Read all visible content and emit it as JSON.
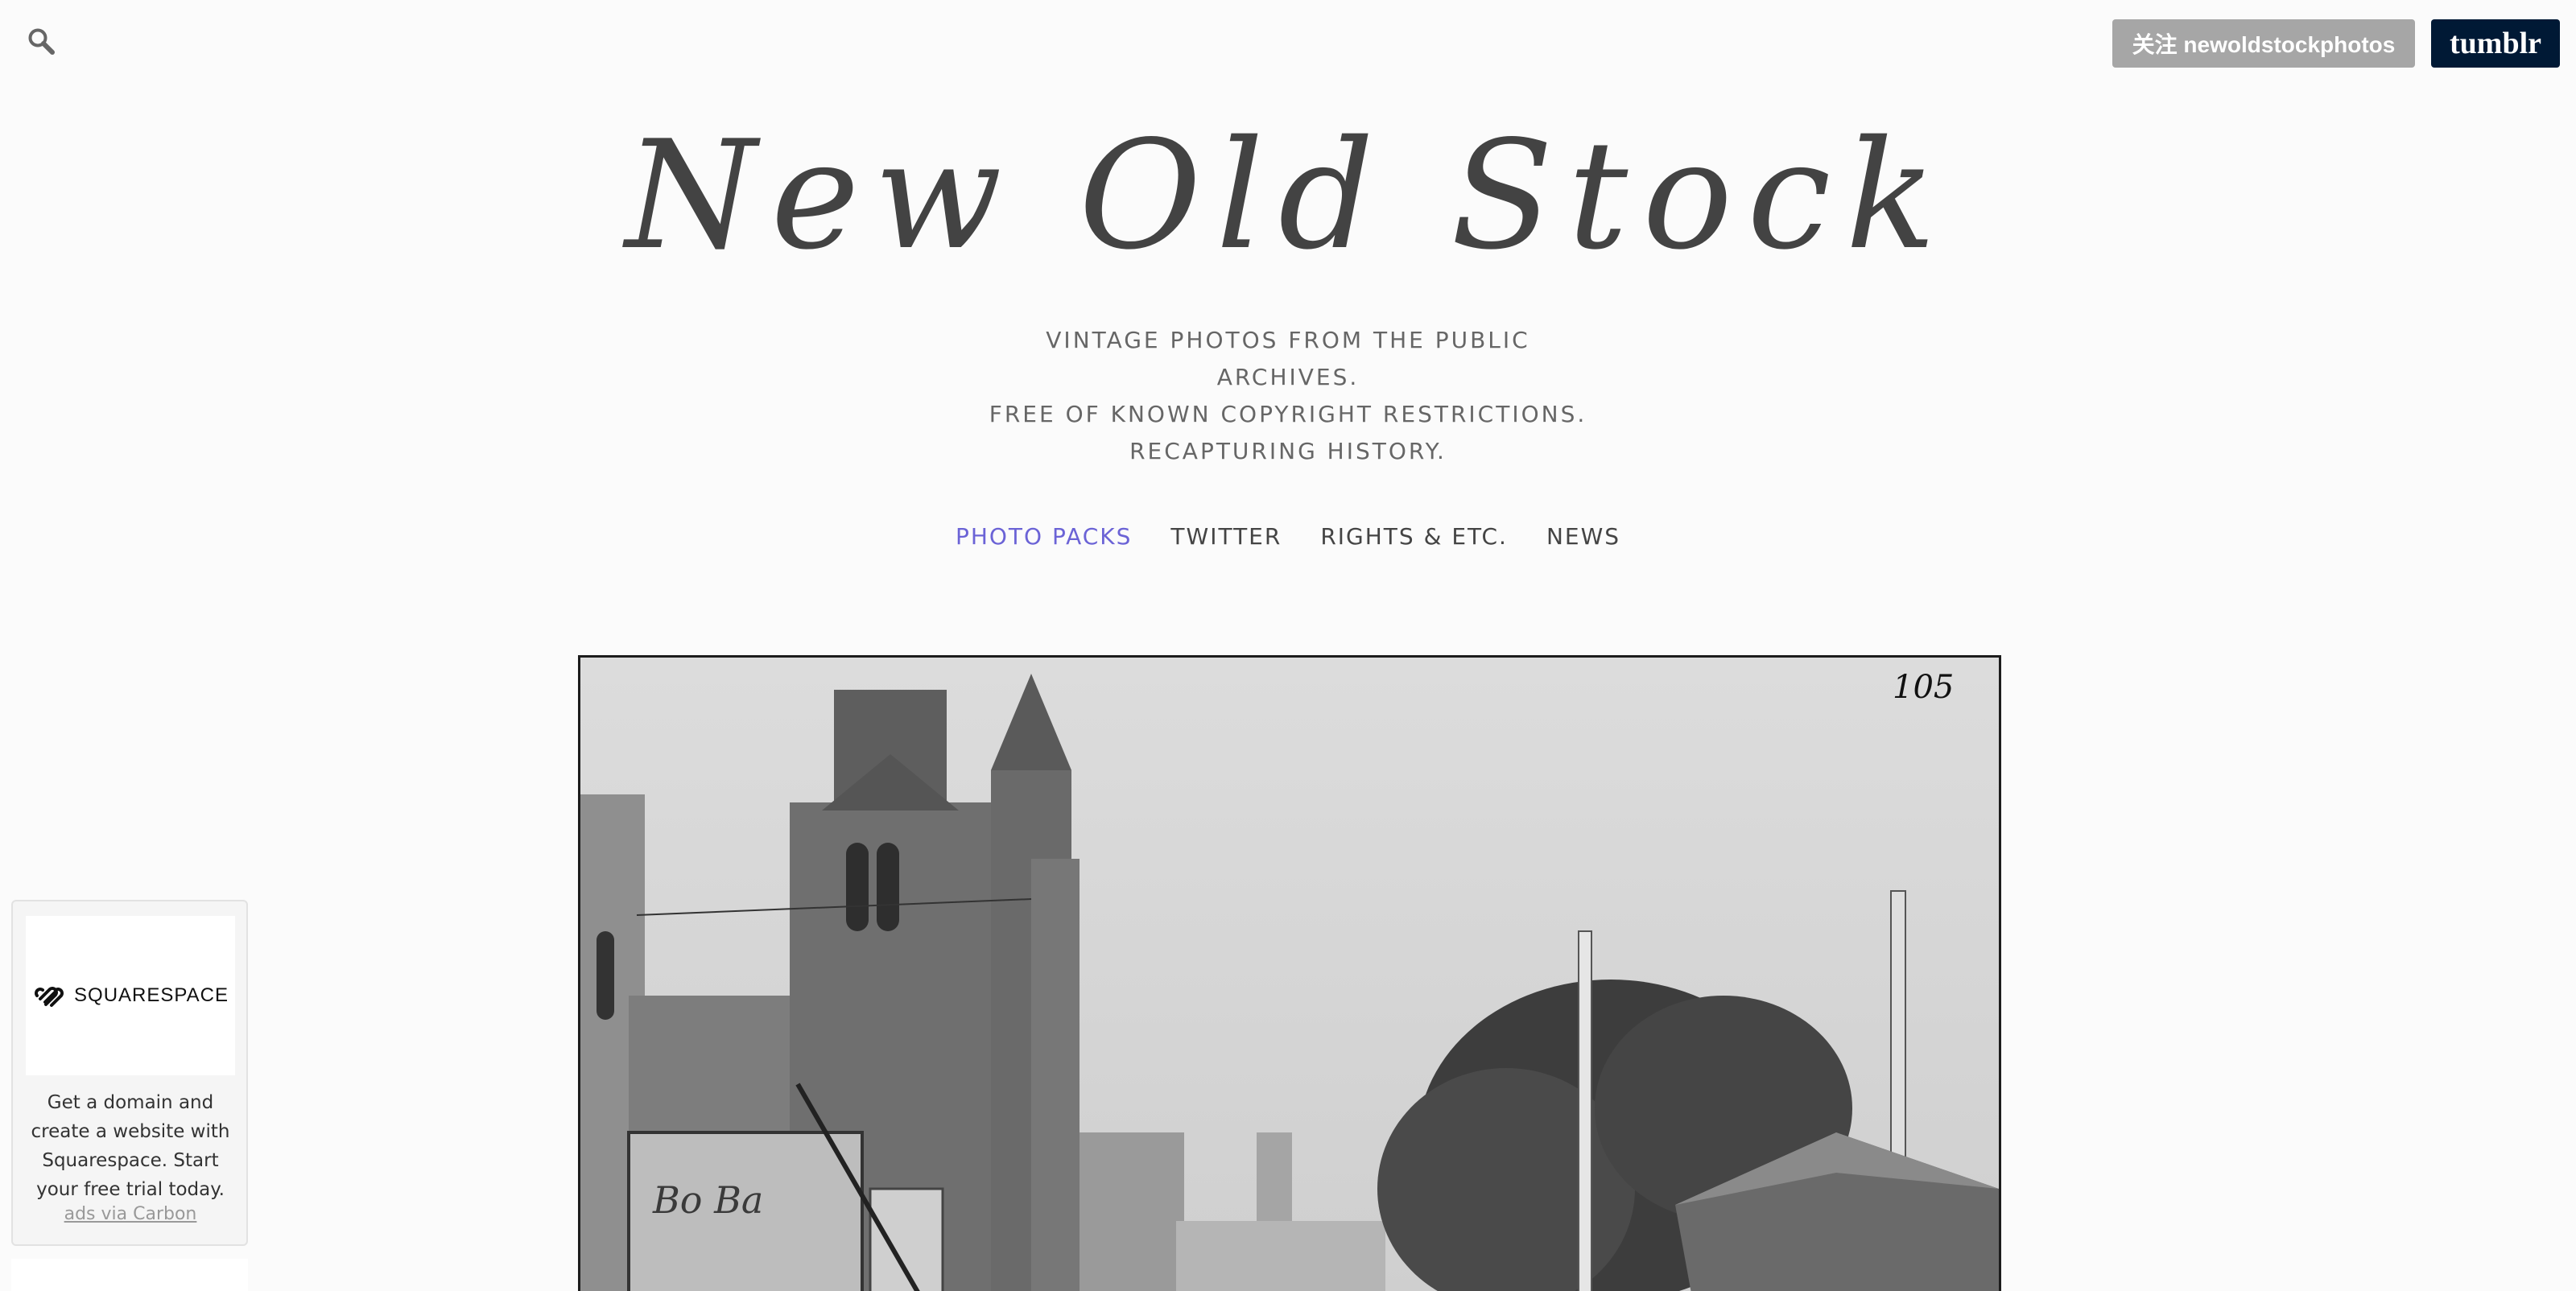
{
  "header": {
    "follow_label": "关注 newoldstockphotos",
    "tumblr_label": "tumblr"
  },
  "site": {
    "title": "New Old Stock",
    "tagline": [
      "VINTAGE PHOTOS FROM THE PUBLIC",
      "ARCHIVES.",
      "FREE OF KNOWN COPYRIGHT RESTRICTIONS.",
      "RECAPTURING HISTORY."
    ]
  },
  "nav": {
    "items": [
      {
        "label": "PHOTO PACKS",
        "active": true
      },
      {
        "label": "TWITTER",
        "active": false
      },
      {
        "label": "RIGHTS & ETC.",
        "active": false
      },
      {
        "label": "NEWS",
        "active": false
      }
    ]
  },
  "photo": {
    "plate_number": "105"
  },
  "ad": {
    "brand": "SQUARESPACE",
    "text": "Get a domain and create a website with Squarespace. Start your free trial today.",
    "link": "ads via Carbon"
  },
  "colors": {
    "nav_active": "#6b63d6",
    "tumblr_bg": "#001935",
    "follow_bg": "#a6a6a6"
  }
}
